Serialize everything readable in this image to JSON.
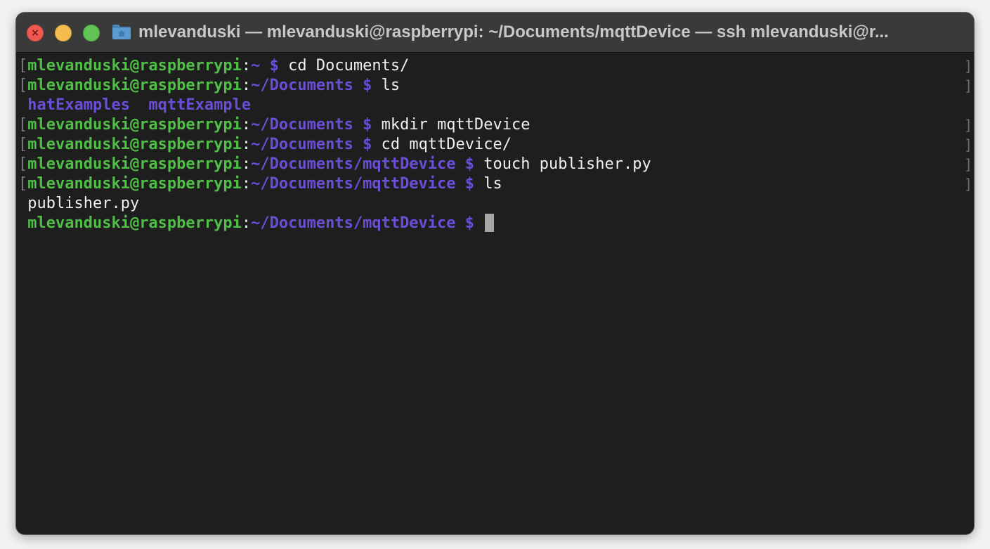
{
  "window": {
    "title": "mlevanduski — mlevanduski@raspberrypi: ~/Documents/mqttDevice — ssh mlevanduski@r..."
  },
  "icons": {
    "close": "close-icon",
    "minimize": "minimize-icon",
    "zoom": "zoom-icon",
    "folder": "home-folder-icon"
  },
  "colors": {
    "prompt_user": "#4fbf45",
    "prompt_path": "#6a4fd6",
    "directory": "#6a4fd6",
    "text": "#f0f0f0",
    "background": "#1e1e1e"
  },
  "terminal": {
    "lines": [
      {
        "user": "mlevanduski@raspberrypi",
        "colon": ":",
        "path": "~",
        "dollar": "$",
        "cmd": "cd Documents/"
      },
      {
        "user": "mlevanduski@raspberrypi",
        "colon": ":",
        "path": "~/Documents",
        "dollar": "$",
        "cmd": "ls"
      },
      {
        "dir1": "hatExamples",
        "dir2": "mqttExample"
      },
      {
        "user": "mlevanduski@raspberrypi",
        "colon": ":",
        "path": "~/Documents",
        "dollar": "$",
        "cmd": "mkdir mqttDevice"
      },
      {
        "user": "mlevanduski@raspberrypi",
        "colon": ":",
        "path": "~/Documents",
        "dollar": "$",
        "cmd": "cd mqttDevice/"
      },
      {
        "user": "mlevanduski@raspberrypi",
        "colon": ":",
        "path": "~/Documents/mqttDevice",
        "dollar": "$",
        "cmd": "touch publisher.py"
      },
      {
        "user": "mlevanduski@raspberrypi",
        "colon": ":",
        "path": "~/Documents/mqttDevice",
        "dollar": "$",
        "cmd": "ls"
      },
      {
        "file": "publisher.py"
      },
      {
        "user": "mlevanduski@raspberrypi",
        "colon": ":",
        "path": "~/Documents/mqttDevice",
        "dollar": "$"
      }
    ]
  }
}
